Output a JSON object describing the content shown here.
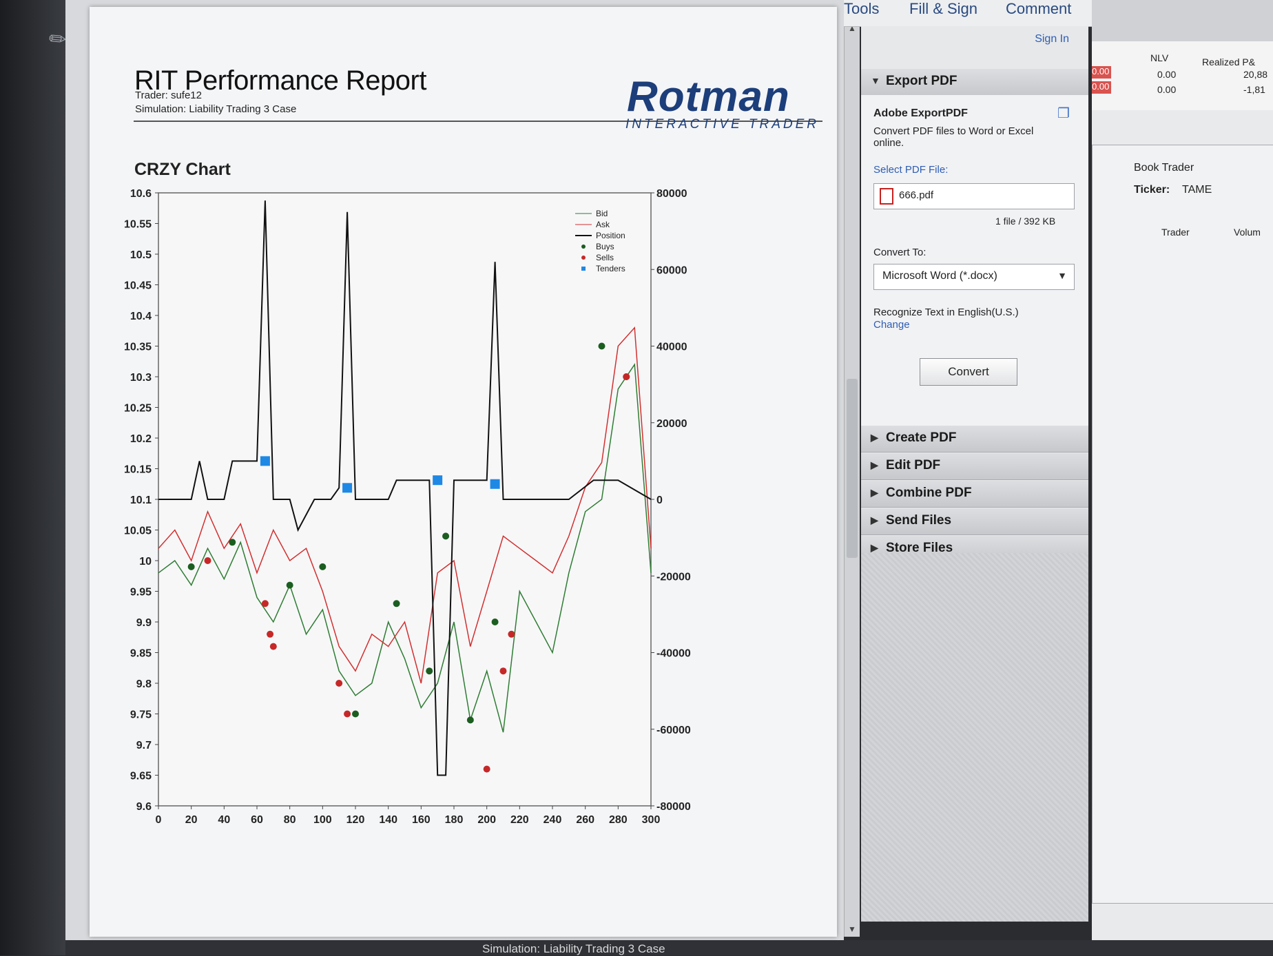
{
  "report": {
    "title": "RIT Performance Report",
    "trader": "Trader: sufe12",
    "simulation": "Simulation: Liability Trading 3 Case",
    "logo_main": "Rotman",
    "logo_sub": "INTERACTIVE TRADER"
  },
  "chart_data": {
    "type": "line",
    "title": "CRZY Chart",
    "x_ticks": [
      "0",
      "20",
      "40",
      "60",
      "80",
      "100",
      "120",
      "140",
      "160",
      "180",
      "200",
      "220",
      "240",
      "260",
      "280",
      "300"
    ],
    "y_left_ticks": [
      "10.6",
      "10.55",
      "10.5",
      "10.45",
      "10.4",
      "10.35",
      "10.3",
      "10.25",
      "10.2",
      "10.15",
      "10.1",
      "10.05",
      "10",
      "9.95",
      "9.9",
      "9.85",
      "9.8",
      "9.75",
      "9.7",
      "9.65",
      "9.6"
    ],
    "y_right_ticks": [
      "80000",
      "60000",
      "40000",
      "20000",
      "0",
      "-20000",
      "-40000",
      "-60000",
      "-80000"
    ],
    "xlim": [
      0,
      300
    ],
    "ylim_left": [
      9.6,
      10.6
    ],
    "ylim_right": [
      -80000,
      80000
    ],
    "legend": [
      "Bid",
      "Ask",
      "Position",
      "Buys",
      "Sells",
      "Tenders"
    ],
    "legend_position": "top-right",
    "colors": {
      "bid": "#2e7d32",
      "ask": "#d32f2f",
      "position": "#111111",
      "buys": "#1b5e20",
      "sells": "#c62828",
      "tenders": "#1e88e5"
    },
    "series": [
      {
        "name": "Bid",
        "axis": "left",
        "points": [
          [
            0,
            9.98
          ],
          [
            10,
            10.0
          ],
          [
            20,
            9.96
          ],
          [
            30,
            10.02
          ],
          [
            40,
            9.97
          ],
          [
            50,
            10.03
          ],
          [
            60,
            9.94
          ],
          [
            70,
            9.9
          ],
          [
            80,
            9.96
          ],
          [
            90,
            9.88
          ],
          [
            100,
            9.92
          ],
          [
            110,
            9.82
          ],
          [
            120,
            9.78
          ],
          [
            130,
            9.8
          ],
          [
            140,
            9.9
          ],
          [
            150,
            9.84
          ],
          [
            160,
            9.76
          ],
          [
            170,
            9.8
          ],
          [
            180,
            9.9
          ],
          [
            190,
            9.74
          ],
          [
            200,
            9.82
          ],
          [
            210,
            9.72
          ],
          [
            220,
            9.95
          ],
          [
            230,
            9.9
          ],
          [
            240,
            9.85
          ],
          [
            250,
            9.98
          ],
          [
            260,
            10.08
          ],
          [
            270,
            10.1
          ],
          [
            280,
            10.28
          ],
          [
            290,
            10.32
          ],
          [
            300,
            9.98
          ]
        ]
      },
      {
        "name": "Ask",
        "axis": "left",
        "points": [
          [
            0,
            10.02
          ],
          [
            10,
            10.05
          ],
          [
            20,
            10.0
          ],
          [
            30,
            10.08
          ],
          [
            40,
            10.02
          ],
          [
            50,
            10.06
          ],
          [
            60,
            9.98
          ],
          [
            70,
            10.05
          ],
          [
            80,
            10.0
          ],
          [
            90,
            10.02
          ],
          [
            100,
            9.95
          ],
          [
            110,
            9.86
          ],
          [
            120,
            9.82
          ],
          [
            130,
            9.88
          ],
          [
            140,
            9.86
          ],
          [
            150,
            9.9
          ],
          [
            160,
            9.8
          ],
          [
            170,
            9.98
          ],
          [
            180,
            10.0
          ],
          [
            190,
            9.86
          ],
          [
            200,
            9.95
          ],
          [
            210,
            10.04
          ],
          [
            220,
            10.02
          ],
          [
            230,
            10.0
          ],
          [
            240,
            9.98
          ],
          [
            250,
            10.04
          ],
          [
            260,
            10.12
          ],
          [
            270,
            10.16
          ],
          [
            280,
            10.35
          ],
          [
            290,
            10.38
          ],
          [
            300,
            10.02
          ]
        ]
      },
      {
        "name": "Position",
        "axis": "right",
        "points": [
          [
            0,
            0
          ],
          [
            20,
            0
          ],
          [
            25,
            10000
          ],
          [
            30,
            0
          ],
          [
            40,
            0
          ],
          [
            45,
            10000
          ],
          [
            60,
            10000
          ],
          [
            65,
            78000
          ],
          [
            70,
            0
          ],
          [
            80,
            0
          ],
          [
            85,
            -8000
          ],
          [
            95,
            0
          ],
          [
            105,
            0
          ],
          [
            110,
            3000
          ],
          [
            115,
            75000
          ],
          [
            120,
            0
          ],
          [
            140,
            0
          ],
          [
            145,
            5000
          ],
          [
            165,
            5000
          ],
          [
            170,
            -72000
          ],
          [
            175,
            -72000
          ],
          [
            180,
            5000
          ],
          [
            200,
            5000
          ],
          [
            205,
            62000
          ],
          [
            210,
            0
          ],
          [
            230,
            0
          ],
          [
            250,
            0
          ],
          [
            265,
            5000
          ],
          [
            280,
            5000
          ],
          [
            300,
            0
          ]
        ]
      },
      {
        "name": "Buys",
        "axis": "left",
        "points": [
          [
            20,
            9.99
          ],
          [
            45,
            10.03
          ],
          [
            80,
            9.96
          ],
          [
            100,
            9.99
          ],
          [
            120,
            9.75
          ],
          [
            145,
            9.93
          ],
          [
            165,
            9.82
          ],
          [
            175,
            10.04
          ],
          [
            190,
            9.74
          ],
          [
            205,
            9.9
          ],
          [
            270,
            10.35
          ],
          [
            285,
            10.3
          ]
        ]
      },
      {
        "name": "Sells",
        "axis": "left",
        "points": [
          [
            30,
            10.0
          ],
          [
            65,
            9.93
          ],
          [
            68,
            9.88
          ],
          [
            70,
            9.86
          ],
          [
            110,
            9.8
          ],
          [
            115,
            9.75
          ],
          [
            200,
            9.66
          ],
          [
            210,
            9.82
          ],
          [
            215,
            9.88
          ],
          [
            285,
            10.3
          ]
        ]
      },
      {
        "name": "Tenders",
        "axis": "right",
        "points": [
          [
            65,
            10000
          ],
          [
            115,
            3000
          ],
          [
            170,
            5000
          ],
          [
            205,
            4000
          ]
        ]
      }
    ]
  },
  "scrollbar": {
    "up": "▲",
    "down": "▼"
  },
  "toolbar": {
    "tools": "Tools",
    "fill_sign": "Fill & Sign",
    "comment": "Comment"
  },
  "panel": {
    "sign_in": "Sign In",
    "export_pdf": "Export PDF",
    "adobe_export": "Adobe ExportPDF",
    "export_desc": "Convert PDF files to Word or Excel online.",
    "select_file_label": "Select PDF File:",
    "file_name": "666.pdf",
    "file_info": "1 file / 392 KB",
    "convert_to_label": "Convert To:",
    "convert_to_value": "Microsoft Word (*.docx)",
    "recognize_text": "Recognize Text in English(U.S.)",
    "change": "Change",
    "convert_button": "Convert",
    "sections": [
      "Create PDF",
      "Edit PDF",
      "Combine PDF",
      "Send Files",
      "Store Files"
    ]
  },
  "rit": {
    "nlv_header": "NLV",
    "realized_header": "Realized P&",
    "rows": [
      {
        "red": "0.00",
        "nlv": "0.00",
        "realized": "20,88"
      },
      {
        "red": "0.00",
        "nlv": "0.00",
        "realized": "-1,81"
      }
    ],
    "book_trader": "Book Trader",
    "ticker_label": "Ticker:",
    "ticker_value": "TAME",
    "col_trader": "Trader",
    "col_volume": "Volum"
  },
  "status": {
    "simulation_text": "Simulation: Liability Trading 3 Case"
  }
}
